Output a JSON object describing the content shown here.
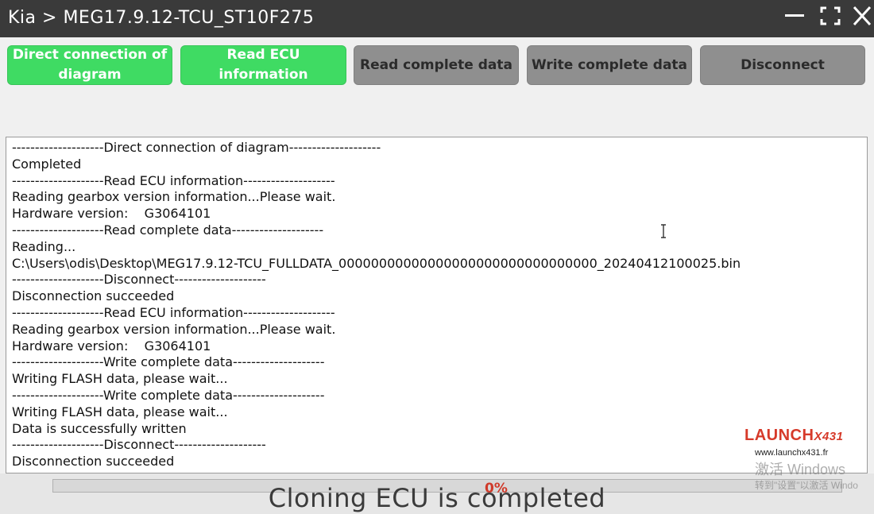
{
  "window": {
    "title": "Kia > MEG17.9.12-TCU_ST10F275"
  },
  "toolbar": {
    "buttons": [
      {
        "label": "Direct connection of diagram",
        "state": "active"
      },
      {
        "label": "Read ECU information",
        "state": "active"
      },
      {
        "label": "Read complete data",
        "state": "disabled"
      },
      {
        "label": "Write complete data",
        "state": "disabled"
      },
      {
        "label": "Disconnect",
        "state": "disabled"
      }
    ]
  },
  "log": {
    "lines": [
      "--------------------Direct connection of diagram--------------------",
      "Completed",
      "--------------------Read ECU information--------------------",
      "Reading gearbox version information...Please wait.",
      "Hardware version:    G3064101",
      "--------------------Read complete data--------------------",
      "Reading...",
      "C:\\Users\\odis\\Desktop\\MEG17.9.12-TCU_FULLDATA_00000000000000000000000000000000_20240412100025.bin",
      "--------------------Disconnect--------------------",
      "Disconnection succeeded",
      "--------------------Read ECU information--------------------",
      "Reading gearbox version information...Please wait.",
      "Hardware version:    G3064101",
      "--------------------Write complete data--------------------",
      "Writing FLASH data, please wait...",
      "--------------------Write complete data--------------------",
      "Writing FLASH data, please wait...",
      "Data is successfully written",
      "--------------------Disconnect--------------------",
      "Disconnection succeeded"
    ]
  },
  "progress": {
    "text": "0%",
    "value": 0
  },
  "overlay": {
    "caption": "Cloning ECU is completed",
    "brand_name": "LAUNCH",
    "brand_suffix": "X431",
    "brand_url": "www.launchx431.fr",
    "activation_line1": "激活 Windows",
    "activation_line2": "转到\"设置\"以激活 Windo"
  },
  "colors": {
    "title_bar": "#3a3a3a",
    "button_green": "#3fdb63",
    "button_gray": "#8f8f8f",
    "progress_text": "#d03a2a",
    "brand": "#d63a2a"
  },
  "icons": [
    "minimize-icon",
    "maximize-icon",
    "close-icon",
    "text-cursor-icon"
  ]
}
